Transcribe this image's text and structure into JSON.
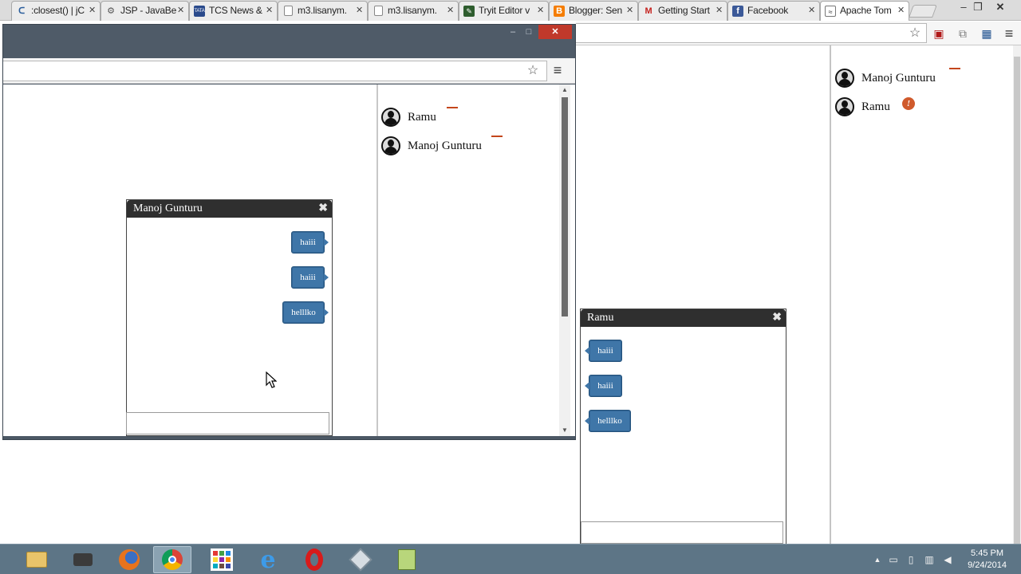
{
  "browser": {
    "tabs": [
      {
        "label": ":closest() | jC",
        "icon": "jquery-icon"
      },
      {
        "label": "JSP - JavaBe",
        "icon": "gear-icon"
      },
      {
        "label": "TCS News &",
        "icon": "tata-icon"
      },
      {
        "label": "m3.lisanym.",
        "icon": "page-icon"
      },
      {
        "label": "m3.lisanym.",
        "icon": "page-icon"
      },
      {
        "label": "Tryit Editor v",
        "icon": "tryit-icon"
      },
      {
        "label": "Blogger: Sen",
        "icon": "blogger-icon"
      },
      {
        "label": "Getting Start",
        "icon": "gmail-icon"
      },
      {
        "label": "Facebook",
        "icon": "facebook-icon"
      },
      {
        "label": "Apache Tom",
        "icon": "tomcat-icon"
      }
    ],
    "active_tab_index": 9
  },
  "main_page": {
    "users": [
      {
        "name": "Manoj Gunturu",
        "status": "minimized"
      },
      {
        "name": "Ramu",
        "status": "alert",
        "badge": "!"
      }
    ],
    "chat": {
      "title": "Ramu",
      "close_glyph": "✖",
      "messages": [
        "haiii",
        "haiii",
        "helllko"
      ],
      "input_value": ""
    }
  },
  "popup_page": {
    "users": [
      {
        "name": "Ramu",
        "status": "minimized"
      },
      {
        "name": "Manoj Gunturu",
        "status": "minimized"
      }
    ],
    "chat": {
      "title": "Manoj Gunturu",
      "close_glyph": "✖",
      "messages": [
        "haiii",
        "haiii",
        "helllko"
      ],
      "input_value": ""
    }
  },
  "taskbar": {
    "apps": [
      "file-explorer-icon",
      "printer-icon",
      "firefox-icon",
      "chrome-icon",
      "app-grid-icon",
      "ie-icon",
      "opera-icon",
      "virtualbox-icon",
      "notepad-icon"
    ],
    "active_app_index": 3,
    "time": "5:45 PM",
    "date": "9/24/2014"
  },
  "colors": {
    "bubble": "#3f76a8",
    "chat_header": "#2f2f2f",
    "popup_frame": "#4c5865",
    "close_button": "#c0392b",
    "taskbar": "#5d7586",
    "status_dash": "#c4461b"
  }
}
